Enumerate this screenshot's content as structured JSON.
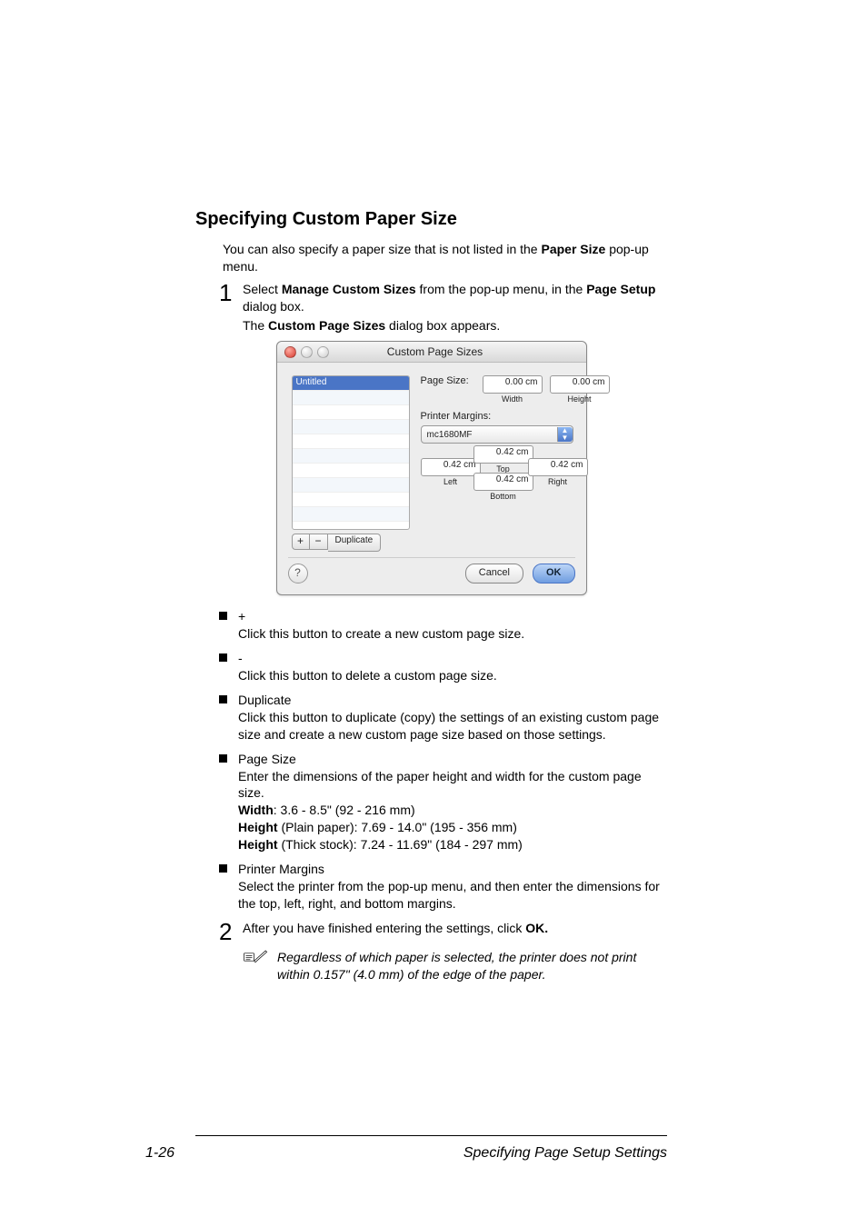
{
  "heading": "Specifying Custom Paper Size",
  "intro": {
    "pre": "You can also specify a paper size that is not listed in the ",
    "strong": "Paper Size",
    "post": " pop-up menu."
  },
  "step1": {
    "num": "1",
    "pre": "Select ",
    "strong1": "Manage Custom Sizes",
    "mid": " from the pop-up menu, in the ",
    "strong2": "Page Setup",
    "post": " dialog box.",
    "line2_pre": "The ",
    "line2_strong": "Custom Page Sizes",
    "line2_post": " dialog box appears."
  },
  "dialog": {
    "title": "Custom Page Sizes",
    "list_selected": "Untitled",
    "btn_plus": "+",
    "btn_minus": "−",
    "btn_duplicate": "Duplicate",
    "page_size_label": "Page Size:",
    "width_val": "0.00 cm",
    "width_sub": "Width",
    "height_val": "0.00 cm",
    "height_sub": "Height",
    "printer_margins_label": "Printer Margins:",
    "printer_popup": "mc1680MF",
    "margins": {
      "left_val": "0.42 cm",
      "left_sub": "Left",
      "top_val": "0.42 cm",
      "top_sub": "Top",
      "right_val": "0.42 cm",
      "right_sub": "Right",
      "bottom_val": "0.42 cm",
      "bottom_sub": "Bottom"
    },
    "help": "?",
    "cancel": "Cancel",
    "ok": "OK"
  },
  "bullets": {
    "plus": {
      "term": "+",
      "desc": "Click this button to create a new custom page size."
    },
    "minus": {
      "term": "-",
      "desc": "Click this button to delete a custom page size."
    },
    "duplicate": {
      "term": "Duplicate",
      "desc": "Click this button to duplicate (copy) the settings of an existing custom page size and create a new custom page size based on those settings."
    },
    "pagesize": {
      "term": "Page Size",
      "desc": "Enter the dimensions of the paper height and width for the custom page size.",
      "width_label": "Width",
      "width_text": ":   3.6 - 8.5\" (92 - 216 mm)",
      "hplain_label": "Height",
      "hplain_text": " (Plain paper): 7.69 - 14.0\" (195 - 356 mm)",
      "hstock_label": "Height",
      "hstock_text": " (Thick stock): 7.24 - 11.69\" (184 - 297 mm)"
    },
    "margins": {
      "term": "Printer Margins",
      "desc": "Select the printer from the pop-up menu, and then enter the dimensions for the top, left, right, and bottom margins."
    }
  },
  "step2": {
    "num": "2",
    "pre": "After you have finished entering the settings, click ",
    "strong": "OK."
  },
  "note": "Regardless of which paper is selected, the printer does not print within 0.157\" (4.0 mm) of the edge of the paper.",
  "footer": {
    "page": "1-26",
    "title": "Specifying Page Setup Settings"
  }
}
